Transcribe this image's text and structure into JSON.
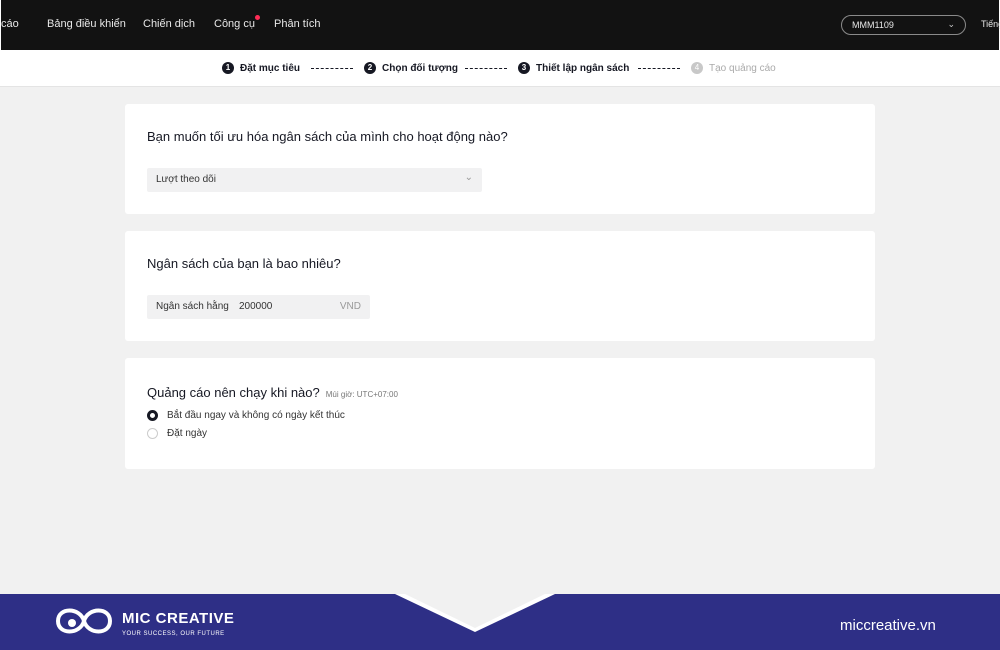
{
  "nav": {
    "partial_left": "cáo",
    "items": [
      "Bảng điều khiển",
      "Chiến dịch",
      "Công cụ",
      "Phân tích"
    ],
    "account": "MMM1109",
    "language": "Tiếng"
  },
  "steps": [
    {
      "num": "1",
      "label": "Đặt mục tiêu"
    },
    {
      "num": "2",
      "label": "Chọn đối tượng"
    },
    {
      "num": "3",
      "label": "Thiết lập ngân sách"
    },
    {
      "num": "4",
      "label": "Tạo quảng cáo"
    }
  ],
  "optimize": {
    "question": "Bạn muốn tối ưu hóa ngân sách của mình cho hoạt động nào?",
    "selected": "Lượt theo dõi"
  },
  "budget": {
    "question": "Ngân sách của bạn là bao nhiêu?",
    "label": "Ngân sách hằng",
    "value": "200000",
    "currency": "VND"
  },
  "schedule": {
    "question": "Quảng cáo nên chạy khi nào?",
    "timezone": "Múi giờ: UTC+07:00",
    "options": [
      "Bắt đầu ngay và không có ngày kết thúc",
      "Đặt ngày"
    ],
    "selected_index": 0
  },
  "footer": {
    "brand": "MIC CREATIVE",
    "tagline": "YOUR SUCCESS, OUR FUTURE",
    "website": "miccreative.vn"
  },
  "colors": {
    "nav_bg": "#121212",
    "footer_bg": "#2e2f86",
    "notification_dot": "#fe2c55"
  }
}
